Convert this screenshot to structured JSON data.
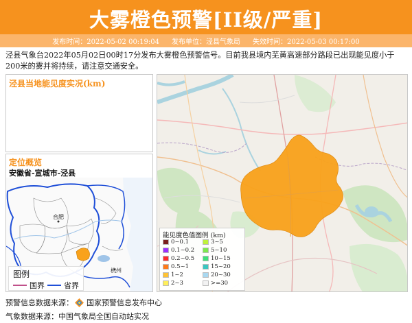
{
  "header": {
    "title": "大雾橙色预警[II级/严重]",
    "publish_time": "发布时间：2022-05-02 00:19:04",
    "publisher": "发布单位：泾县气象局",
    "expire_time": "失效时间：2022-05-03 00:17:00",
    "bg_color": "#f6921e"
  },
  "description": "泾县气象台2022年05月02日00时17分发布大雾橙色预警信号。目前我县境内芜黄高速部分路段已出现能见度小于200米的雾并将持续，请注意交通安全。",
  "visibility_panel": {
    "title": "泾县当地能见度实况(km)"
  },
  "location_panel": {
    "title": "定位概览",
    "location": "安徽省-宣城市-泾县",
    "map_labels": [
      "合肥",
      "杭州"
    ]
  },
  "boundary_legend": {
    "title": "图例",
    "items": [
      {
        "label": "国界",
        "color": "#c0508a"
      },
      {
        "label": "省界",
        "color": "#1f4fd8"
      }
    ]
  },
  "visibility_legend": {
    "title": "能见度色值图例 (km)",
    "items": [
      {
        "label": "0~0.1",
        "color": "#7a1f1f"
      },
      {
        "label": "0.1~0.2",
        "color": "#9b30ff"
      },
      {
        "label": "0.2~0.5",
        "color": "#ff2b2b"
      },
      {
        "label": "0.5~1",
        "color": "#ff7a1a"
      },
      {
        "label": "1~2",
        "color": "#ffc233"
      },
      {
        "label": "2~3",
        "color": "#ffef5a"
      },
      {
        "label": "3~5",
        "color": "#bff23a"
      },
      {
        "label": "5~10",
        "color": "#7de84e"
      },
      {
        "label": "10~15",
        "color": "#3fe07a"
      },
      {
        "label": "15~20",
        "color": "#3cc6c0"
      },
      {
        "label": "20~30",
        "color": "#a9d8f0"
      },
      {
        "label": ">=30",
        "color": "#f2f2f2"
      }
    ]
  },
  "footer": {
    "warning_source": "预警信息数据来源：",
    "warning_source_name": "国家预警信息发布中心",
    "weather_source": "气象数据来源：中国气象局全国自动站实况"
  },
  "fog_area_color": "#f9a21b"
}
